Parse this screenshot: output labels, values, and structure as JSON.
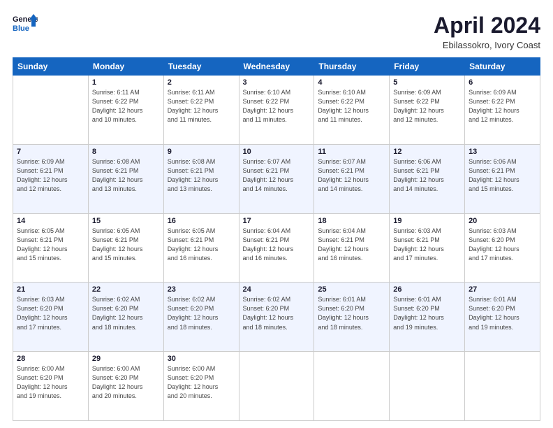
{
  "header": {
    "logo_line1": "General",
    "logo_line2": "Blue",
    "month": "April 2024",
    "location": "Ebilassokro, Ivory Coast"
  },
  "weekdays": [
    "Sunday",
    "Monday",
    "Tuesday",
    "Wednesday",
    "Thursday",
    "Friday",
    "Saturday"
  ],
  "weeks": [
    [
      {
        "day": "",
        "detail": ""
      },
      {
        "day": "1",
        "detail": "Sunrise: 6:11 AM\nSunset: 6:22 PM\nDaylight: 12 hours\nand 10 minutes."
      },
      {
        "day": "2",
        "detail": "Sunrise: 6:11 AM\nSunset: 6:22 PM\nDaylight: 12 hours\nand 11 minutes."
      },
      {
        "day": "3",
        "detail": "Sunrise: 6:10 AM\nSunset: 6:22 PM\nDaylight: 12 hours\nand 11 minutes."
      },
      {
        "day": "4",
        "detail": "Sunrise: 6:10 AM\nSunset: 6:22 PM\nDaylight: 12 hours\nand 11 minutes."
      },
      {
        "day": "5",
        "detail": "Sunrise: 6:09 AM\nSunset: 6:22 PM\nDaylight: 12 hours\nand 12 minutes."
      },
      {
        "day": "6",
        "detail": "Sunrise: 6:09 AM\nSunset: 6:22 PM\nDaylight: 12 hours\nand 12 minutes."
      }
    ],
    [
      {
        "day": "7",
        "detail": "Sunrise: 6:09 AM\nSunset: 6:21 PM\nDaylight: 12 hours\nand 12 minutes."
      },
      {
        "day": "8",
        "detail": "Sunrise: 6:08 AM\nSunset: 6:21 PM\nDaylight: 12 hours\nand 13 minutes."
      },
      {
        "day": "9",
        "detail": "Sunrise: 6:08 AM\nSunset: 6:21 PM\nDaylight: 12 hours\nand 13 minutes."
      },
      {
        "day": "10",
        "detail": "Sunrise: 6:07 AM\nSunset: 6:21 PM\nDaylight: 12 hours\nand 14 minutes."
      },
      {
        "day": "11",
        "detail": "Sunrise: 6:07 AM\nSunset: 6:21 PM\nDaylight: 12 hours\nand 14 minutes."
      },
      {
        "day": "12",
        "detail": "Sunrise: 6:06 AM\nSunset: 6:21 PM\nDaylight: 12 hours\nand 14 minutes."
      },
      {
        "day": "13",
        "detail": "Sunrise: 6:06 AM\nSunset: 6:21 PM\nDaylight: 12 hours\nand 15 minutes."
      }
    ],
    [
      {
        "day": "14",
        "detail": "Sunrise: 6:05 AM\nSunset: 6:21 PM\nDaylight: 12 hours\nand 15 minutes."
      },
      {
        "day": "15",
        "detail": "Sunrise: 6:05 AM\nSunset: 6:21 PM\nDaylight: 12 hours\nand 15 minutes."
      },
      {
        "day": "16",
        "detail": "Sunrise: 6:05 AM\nSunset: 6:21 PM\nDaylight: 12 hours\nand 16 minutes."
      },
      {
        "day": "17",
        "detail": "Sunrise: 6:04 AM\nSunset: 6:21 PM\nDaylight: 12 hours\nand 16 minutes."
      },
      {
        "day": "18",
        "detail": "Sunrise: 6:04 AM\nSunset: 6:21 PM\nDaylight: 12 hours\nand 16 minutes."
      },
      {
        "day": "19",
        "detail": "Sunrise: 6:03 AM\nSunset: 6:21 PM\nDaylight: 12 hours\nand 17 minutes."
      },
      {
        "day": "20",
        "detail": "Sunrise: 6:03 AM\nSunset: 6:20 PM\nDaylight: 12 hours\nand 17 minutes."
      }
    ],
    [
      {
        "day": "21",
        "detail": "Sunrise: 6:03 AM\nSunset: 6:20 PM\nDaylight: 12 hours\nand 17 minutes."
      },
      {
        "day": "22",
        "detail": "Sunrise: 6:02 AM\nSunset: 6:20 PM\nDaylight: 12 hours\nand 18 minutes."
      },
      {
        "day": "23",
        "detail": "Sunrise: 6:02 AM\nSunset: 6:20 PM\nDaylight: 12 hours\nand 18 minutes."
      },
      {
        "day": "24",
        "detail": "Sunrise: 6:02 AM\nSunset: 6:20 PM\nDaylight: 12 hours\nand 18 minutes."
      },
      {
        "day": "25",
        "detail": "Sunrise: 6:01 AM\nSunset: 6:20 PM\nDaylight: 12 hours\nand 18 minutes."
      },
      {
        "day": "26",
        "detail": "Sunrise: 6:01 AM\nSunset: 6:20 PM\nDaylight: 12 hours\nand 19 minutes."
      },
      {
        "day": "27",
        "detail": "Sunrise: 6:01 AM\nSunset: 6:20 PM\nDaylight: 12 hours\nand 19 minutes."
      }
    ],
    [
      {
        "day": "28",
        "detail": "Sunrise: 6:00 AM\nSunset: 6:20 PM\nDaylight: 12 hours\nand 19 minutes."
      },
      {
        "day": "29",
        "detail": "Sunrise: 6:00 AM\nSunset: 6:20 PM\nDaylight: 12 hours\nand 20 minutes."
      },
      {
        "day": "30",
        "detail": "Sunrise: 6:00 AM\nSunset: 6:20 PM\nDaylight: 12 hours\nand 20 minutes."
      },
      {
        "day": "",
        "detail": ""
      },
      {
        "day": "",
        "detail": ""
      },
      {
        "day": "",
        "detail": ""
      },
      {
        "day": "",
        "detail": ""
      }
    ]
  ]
}
